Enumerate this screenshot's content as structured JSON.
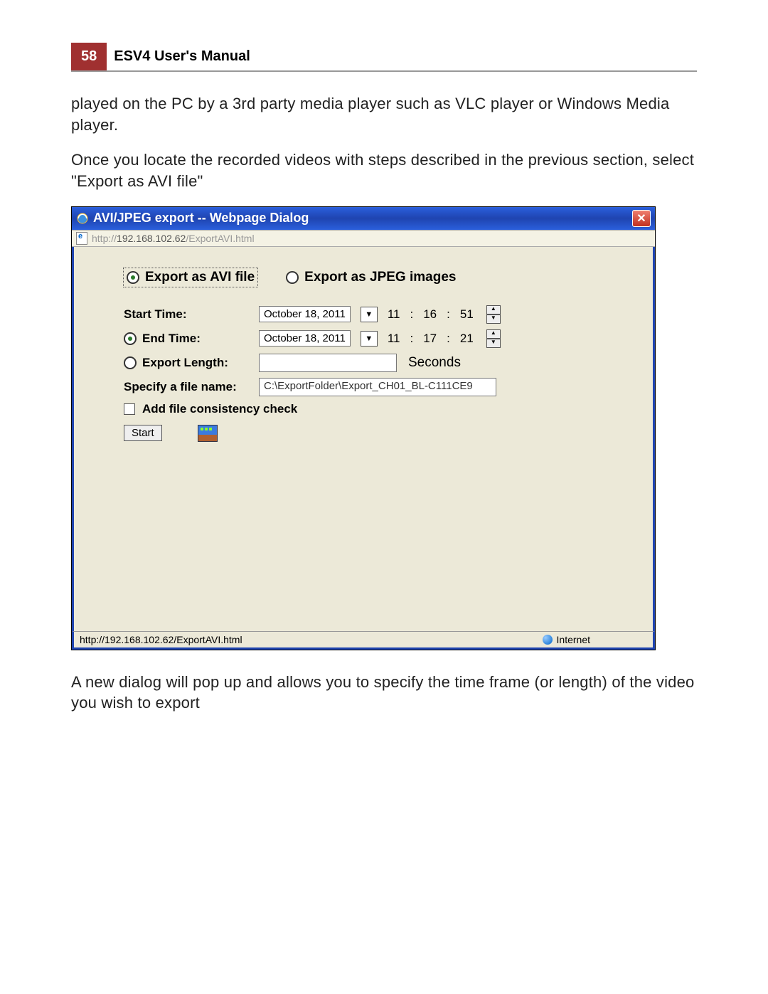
{
  "page_number": "58",
  "manual_title": "ESV4 User's Manual",
  "para1": "played on the PC by a 3rd party media player such as VLC player or Windows Media player.",
  "para2": "Once you locate the recorded videos with steps described in the previous section, select \"Export as AVI file\"",
  "para3": "A new dialog will pop up and allows you to specify the time frame (or length) of the video you wish to export",
  "dialog": {
    "title": "AVI/JPEG export -- Webpage Dialog",
    "address_prefix": "http://",
    "address_host": "192.168.102.62",
    "address_path": "/ExportAVI.html",
    "export_avi_label": "Export as AVI file",
    "export_jpeg_label": "Export as JPEG images",
    "start_time_label": "Start Time:",
    "end_time_label": "End Time:",
    "export_length_label": "Export Length:",
    "seconds_label": "Seconds",
    "specify_filename_label": "Specify a file name:",
    "add_consistency_label": "Add file consistency check",
    "start_button_label": "Start",
    "start_time": {
      "date": "October 18, 2011",
      "h": "11",
      "m": "16",
      "s": "51"
    },
    "end_time": {
      "date": "October 18, 2011",
      "h": "11",
      "m": "17",
      "s": "21"
    },
    "filename_value": "C:\\ExportFolder\\Export_CH01_BL-C111CE9",
    "status_url": "http://192.168.102.62/ExportAVI.html",
    "status_zone": "Internet"
  }
}
